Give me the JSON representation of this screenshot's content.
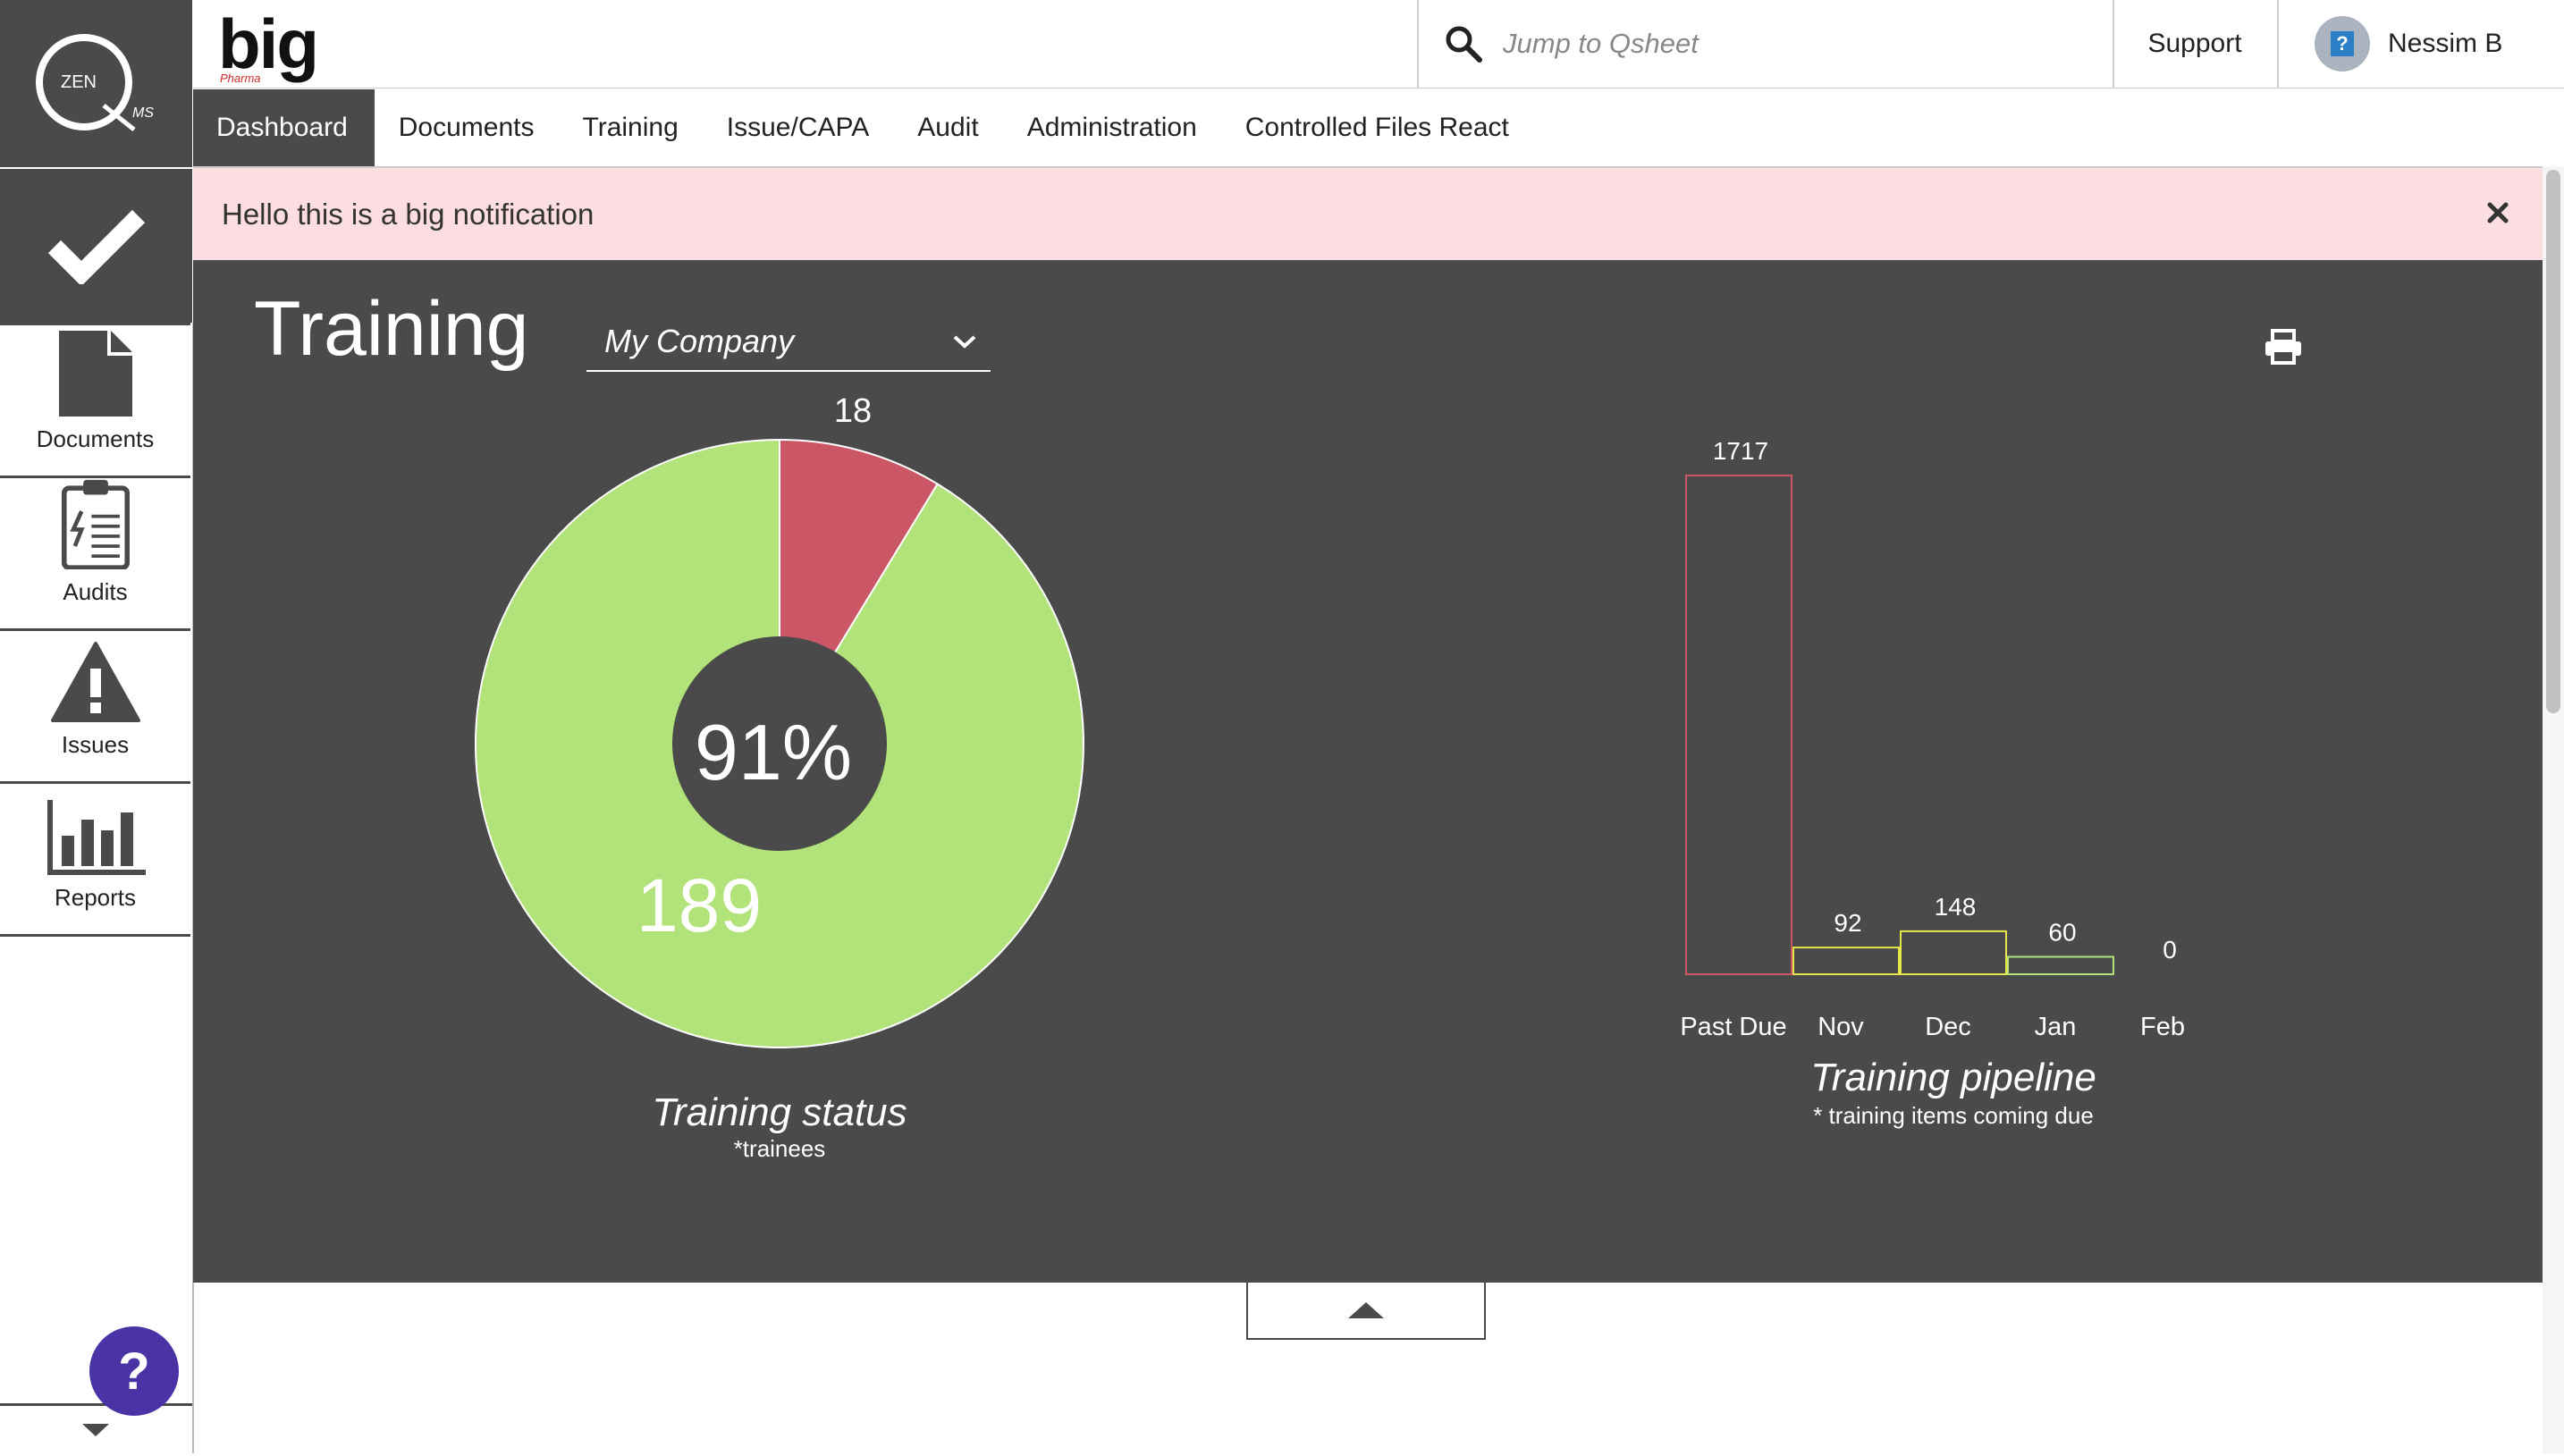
{
  "brand": {
    "name": "big",
    "sub": "Pharma",
    "logo_text": "ZEN",
    "logo_sub": "MS"
  },
  "search": {
    "placeholder": "Jump to Qsheet"
  },
  "header": {
    "support": "Support",
    "user_name": "Nessim B",
    "avatar_glyph": "?"
  },
  "nav": {
    "tabs": [
      {
        "label": "Dashboard",
        "active": true
      },
      {
        "label": "Documents"
      },
      {
        "label": "Training"
      },
      {
        "label": "Issue/CAPA"
      },
      {
        "label": "Audit"
      },
      {
        "label": "Administration"
      },
      {
        "label": "Controlled Files React"
      }
    ]
  },
  "sidebar": {
    "items": [
      {
        "label": "Documents",
        "icon": "document-icon"
      },
      {
        "label": "Audits",
        "icon": "clipboard-icon"
      },
      {
        "label": "Issues",
        "icon": "warning-icon"
      },
      {
        "label": "Reports",
        "icon": "bar-chart-icon"
      }
    ],
    "help": "?"
  },
  "notification": {
    "text": "Hello this is a big notification"
  },
  "panel": {
    "title": "Training",
    "company": "My Company"
  },
  "colors": {
    "dark": "#4a4a4a",
    "green": "#b2e27a",
    "red": "#cb5665",
    "yellow": "#e6e64a",
    "help": "#4a33a5",
    "notif_bg": "#fbdde2"
  },
  "chart_data": [
    {
      "type": "pie",
      "title": "Training status",
      "subtitle": "*trainees",
      "center_label": "91%",
      "slices": [
        {
          "label": "18",
          "value": 18,
          "color": "#cb5665"
        },
        {
          "label": "189",
          "value": 189,
          "color": "#b2e27a"
        }
      ]
    },
    {
      "type": "bar",
      "title": "Training pipeline",
      "subtitle": "* training items coming due",
      "categories": [
        "Past Due",
        "Nov",
        "Dec",
        "Jan",
        "Feb"
      ],
      "values": [
        1717,
        92,
        148,
        60,
        0
      ],
      "colors": [
        "#cb5665",
        "#e6e64a",
        "#e6e64a",
        "#b2e27a",
        "#b2e27a"
      ],
      "ylim": [
        0,
        1717
      ]
    }
  ]
}
